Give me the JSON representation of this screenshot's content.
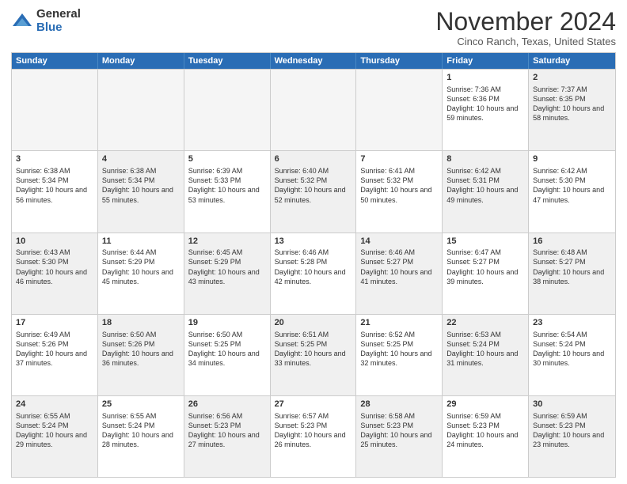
{
  "logo": {
    "general": "General",
    "blue": "Blue"
  },
  "title": "November 2024",
  "location": "Cinco Ranch, Texas, United States",
  "weekdays": [
    "Sunday",
    "Monday",
    "Tuesday",
    "Wednesday",
    "Thursday",
    "Friday",
    "Saturday"
  ],
  "rows": [
    [
      {
        "day": "",
        "info": "",
        "empty": true
      },
      {
        "day": "",
        "info": "",
        "empty": true
      },
      {
        "day": "",
        "info": "",
        "empty": true
      },
      {
        "day": "",
        "info": "",
        "empty": true
      },
      {
        "day": "",
        "info": "",
        "empty": true
      },
      {
        "day": "1",
        "info": "Sunrise: 7:36 AM\nSunset: 6:36 PM\nDaylight: 10 hours and 59 minutes.",
        "empty": false
      },
      {
        "day": "2",
        "info": "Sunrise: 7:37 AM\nSunset: 6:35 PM\nDaylight: 10 hours and 58 minutes.",
        "empty": false,
        "shaded": true
      }
    ],
    [
      {
        "day": "3",
        "info": "Sunrise: 6:38 AM\nSunset: 5:34 PM\nDaylight: 10 hours and 56 minutes.",
        "empty": false
      },
      {
        "day": "4",
        "info": "Sunrise: 6:38 AM\nSunset: 5:34 PM\nDaylight: 10 hours and 55 minutes.",
        "empty": false,
        "shaded": true
      },
      {
        "day": "5",
        "info": "Sunrise: 6:39 AM\nSunset: 5:33 PM\nDaylight: 10 hours and 53 minutes.",
        "empty": false
      },
      {
        "day": "6",
        "info": "Sunrise: 6:40 AM\nSunset: 5:32 PM\nDaylight: 10 hours and 52 minutes.",
        "empty": false,
        "shaded": true
      },
      {
        "day": "7",
        "info": "Sunrise: 6:41 AM\nSunset: 5:32 PM\nDaylight: 10 hours and 50 minutes.",
        "empty": false
      },
      {
        "day": "8",
        "info": "Sunrise: 6:42 AM\nSunset: 5:31 PM\nDaylight: 10 hours and 49 minutes.",
        "empty": false,
        "shaded": true
      },
      {
        "day": "9",
        "info": "Sunrise: 6:42 AM\nSunset: 5:30 PM\nDaylight: 10 hours and 47 minutes.",
        "empty": false
      }
    ],
    [
      {
        "day": "10",
        "info": "Sunrise: 6:43 AM\nSunset: 5:30 PM\nDaylight: 10 hours and 46 minutes.",
        "empty": false,
        "shaded": true
      },
      {
        "day": "11",
        "info": "Sunrise: 6:44 AM\nSunset: 5:29 PM\nDaylight: 10 hours and 45 minutes.",
        "empty": false
      },
      {
        "day": "12",
        "info": "Sunrise: 6:45 AM\nSunset: 5:29 PM\nDaylight: 10 hours and 43 minutes.",
        "empty": false,
        "shaded": true
      },
      {
        "day": "13",
        "info": "Sunrise: 6:46 AM\nSunset: 5:28 PM\nDaylight: 10 hours and 42 minutes.",
        "empty": false
      },
      {
        "day": "14",
        "info": "Sunrise: 6:46 AM\nSunset: 5:27 PM\nDaylight: 10 hours and 41 minutes.",
        "empty": false,
        "shaded": true
      },
      {
        "day": "15",
        "info": "Sunrise: 6:47 AM\nSunset: 5:27 PM\nDaylight: 10 hours and 39 minutes.",
        "empty": false
      },
      {
        "day": "16",
        "info": "Sunrise: 6:48 AM\nSunset: 5:27 PM\nDaylight: 10 hours and 38 minutes.",
        "empty": false,
        "shaded": true
      }
    ],
    [
      {
        "day": "17",
        "info": "Sunrise: 6:49 AM\nSunset: 5:26 PM\nDaylight: 10 hours and 37 minutes.",
        "empty": false
      },
      {
        "day": "18",
        "info": "Sunrise: 6:50 AM\nSunset: 5:26 PM\nDaylight: 10 hours and 36 minutes.",
        "empty": false,
        "shaded": true
      },
      {
        "day": "19",
        "info": "Sunrise: 6:50 AM\nSunset: 5:25 PM\nDaylight: 10 hours and 34 minutes.",
        "empty": false
      },
      {
        "day": "20",
        "info": "Sunrise: 6:51 AM\nSunset: 5:25 PM\nDaylight: 10 hours and 33 minutes.",
        "empty": false,
        "shaded": true
      },
      {
        "day": "21",
        "info": "Sunrise: 6:52 AM\nSunset: 5:25 PM\nDaylight: 10 hours and 32 minutes.",
        "empty": false
      },
      {
        "day": "22",
        "info": "Sunrise: 6:53 AM\nSunset: 5:24 PM\nDaylight: 10 hours and 31 minutes.",
        "empty": false,
        "shaded": true
      },
      {
        "day": "23",
        "info": "Sunrise: 6:54 AM\nSunset: 5:24 PM\nDaylight: 10 hours and 30 minutes.",
        "empty": false
      }
    ],
    [
      {
        "day": "24",
        "info": "Sunrise: 6:55 AM\nSunset: 5:24 PM\nDaylight: 10 hours and 29 minutes.",
        "empty": false,
        "shaded": true
      },
      {
        "day": "25",
        "info": "Sunrise: 6:55 AM\nSunset: 5:24 PM\nDaylight: 10 hours and 28 minutes.",
        "empty": false
      },
      {
        "day": "26",
        "info": "Sunrise: 6:56 AM\nSunset: 5:23 PM\nDaylight: 10 hours and 27 minutes.",
        "empty": false,
        "shaded": true
      },
      {
        "day": "27",
        "info": "Sunrise: 6:57 AM\nSunset: 5:23 PM\nDaylight: 10 hours and 26 minutes.",
        "empty": false
      },
      {
        "day": "28",
        "info": "Sunrise: 6:58 AM\nSunset: 5:23 PM\nDaylight: 10 hours and 25 minutes.",
        "empty": false,
        "shaded": true
      },
      {
        "day": "29",
        "info": "Sunrise: 6:59 AM\nSunset: 5:23 PM\nDaylight: 10 hours and 24 minutes.",
        "empty": false
      },
      {
        "day": "30",
        "info": "Sunrise: 6:59 AM\nSunset: 5:23 PM\nDaylight: 10 hours and 23 minutes.",
        "empty": false,
        "shaded": true
      }
    ]
  ]
}
